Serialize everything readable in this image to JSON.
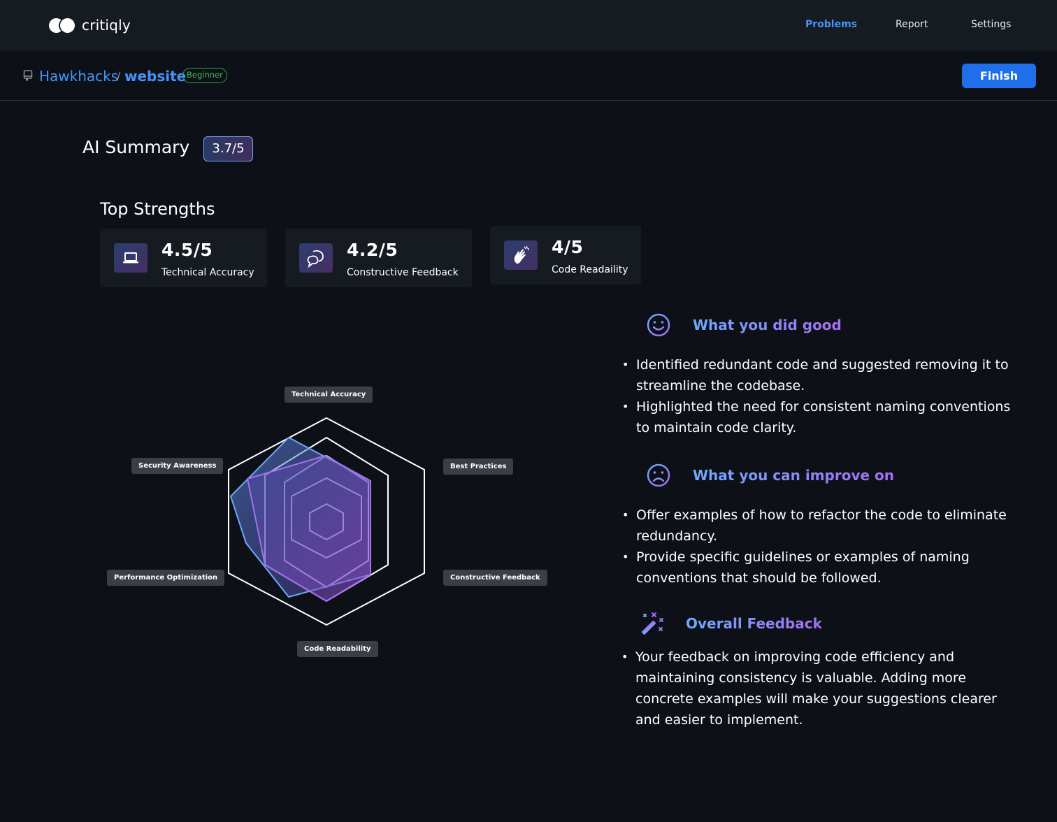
{
  "app": {
    "name": "critiqly"
  },
  "nav": {
    "problems": "Problems",
    "report": "Report",
    "settings": "Settings"
  },
  "repo": {
    "owner": "Hawkhacks",
    "separator": "/",
    "name": "website",
    "level": "Beginner",
    "finish": "Finish"
  },
  "summary": {
    "title": "AI Summary",
    "score": "3.7/5"
  },
  "strengths": {
    "title": "Top Strengths",
    "cards": [
      {
        "score": "4.5/5",
        "label": "Technical Accuracy",
        "icon": "laptop-icon"
      },
      {
        "score": "4.2/5",
        "label": "Constructive Feedback",
        "icon": "chat-bubbles-icon"
      },
      {
        "score": "4/5",
        "label": "Code Readaility",
        "icon": "hand-waving-icon"
      }
    ]
  },
  "radar": {
    "axes": [
      "Technical Accuracy",
      "Best Practices",
      "Constructive Feedback",
      "Code Readability",
      "Performance Optimization",
      "Security Awareness"
    ],
    "colors": {
      "grid": "#ffffff",
      "series_a": "#6ea8fe",
      "series_b": "#a66ef0"
    }
  },
  "good": {
    "title": "What you did good",
    "icon": "smile-icon",
    "items": [
      "Identified redundant code and suggested removing it to streamline the codebase.",
      "Highlighted the need for consistent naming conventions to maintain code clarity."
    ]
  },
  "improve": {
    "title": "What you can improve on",
    "icon": "frown-icon",
    "items": [
      "Offer examples of how to refactor the code to eliminate redundancy.",
      "Provide specific guidelines or examples of naming conventions that should be followed."
    ]
  },
  "overall": {
    "title": "Overall Feedback",
    "icon": "magic-wand-icon",
    "items": [
      "Your feedback on improving code efficiency and maintaining consistency is valuable. Adding more concrete examples will make your suggestions clearer and easier to implement."
    ]
  }
}
